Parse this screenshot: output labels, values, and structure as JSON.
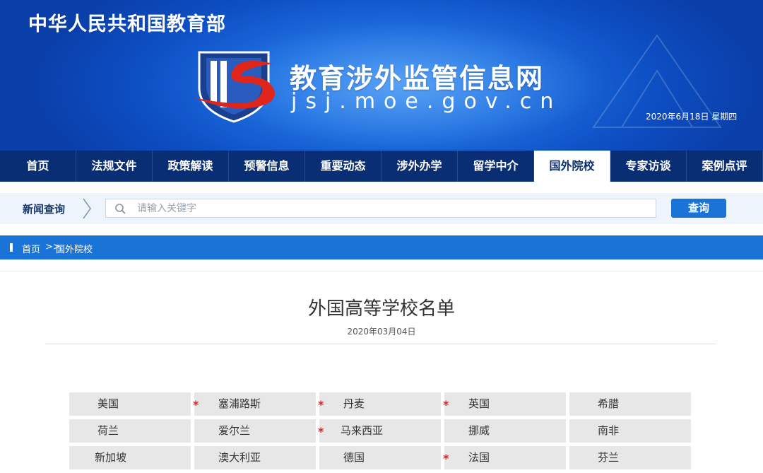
{
  "banner": {
    "ministry": "中华人民共和国教育部",
    "site_title": "教育涉外监管信息网",
    "site_domain": "jsj.moe.gov.cn",
    "date": "2020年6月18日  星期四"
  },
  "nav": {
    "items": [
      {
        "label": "首页",
        "active": false
      },
      {
        "label": "法规文件",
        "active": false
      },
      {
        "label": "政策解读",
        "active": false
      },
      {
        "label": "预警信息",
        "active": false
      },
      {
        "label": "重要动态",
        "active": false
      },
      {
        "label": "涉外办学",
        "active": false
      },
      {
        "label": "留学中介",
        "active": false
      },
      {
        "label": "国外院校",
        "active": true
      },
      {
        "label": "专家访谈",
        "active": false
      },
      {
        "label": "案例点评",
        "active": false
      }
    ]
  },
  "search": {
    "label": "新闻查询",
    "placeholder": "请输入关键字",
    "value": "",
    "button": "查询"
  },
  "breadcrumb": {
    "home": "首页",
    "separator": ">>",
    "current": "国外院校"
  },
  "article": {
    "title": "外国高等学校名单",
    "date": "2020年03月04日"
  },
  "countries": {
    "rows": [
      [
        {
          "name": "美国",
          "star": false
        },
        {
          "name": "塞浦路斯",
          "star": true
        },
        {
          "name": "丹麦",
          "star": true
        },
        {
          "name": "英国",
          "star": true
        },
        {
          "name": "希腊",
          "star": false
        }
      ],
      [
        {
          "name": "荷兰",
          "star": false
        },
        {
          "name": "爱尔兰",
          "star": false
        },
        {
          "name": "马来西亚",
          "star": true
        },
        {
          "name": "挪威",
          "star": false
        },
        {
          "name": "南非",
          "star": false
        }
      ],
      [
        {
          "name": "新加坡",
          "star": false
        },
        {
          "name": "澳大利亚",
          "star": false
        },
        {
          "name": "德国",
          "star": false
        },
        {
          "name": "法国",
          "star": true
        },
        {
          "name": "芬兰",
          "star": false
        }
      ]
    ]
  },
  "icons": {
    "star": "*",
    "chevron": "chevron-right-icon",
    "search": "search-icon"
  },
  "colors": {
    "nav_bg": "#0a2e73",
    "accent_blue": "#1a74d8",
    "star_red": "#e0201b"
  }
}
